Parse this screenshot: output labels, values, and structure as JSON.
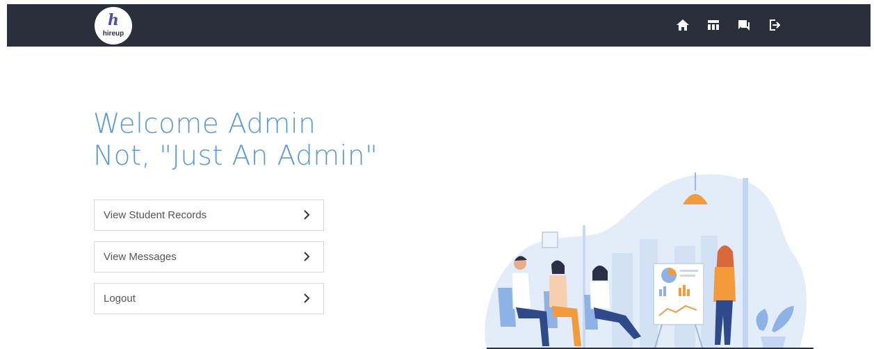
{
  "navbar": {
    "logo_mark": "h",
    "logo_word": "hireup",
    "icons": [
      "home-icon",
      "dashboard-icon",
      "messages-icon",
      "logout-icon"
    ]
  },
  "hero": {
    "line1": "Welcome Admin",
    "line2": "Not, \"Just An Admin\""
  },
  "menu": {
    "items": [
      {
        "label": "View Student Records"
      },
      {
        "label": "View Messages"
      },
      {
        "label": "Logout"
      }
    ]
  },
  "colors": {
    "navbar": "#2b2f3b",
    "accent": "#5a9ad3",
    "illustration_blue": "#dbe7f8",
    "illustration_orange": "#f39a3a"
  }
}
